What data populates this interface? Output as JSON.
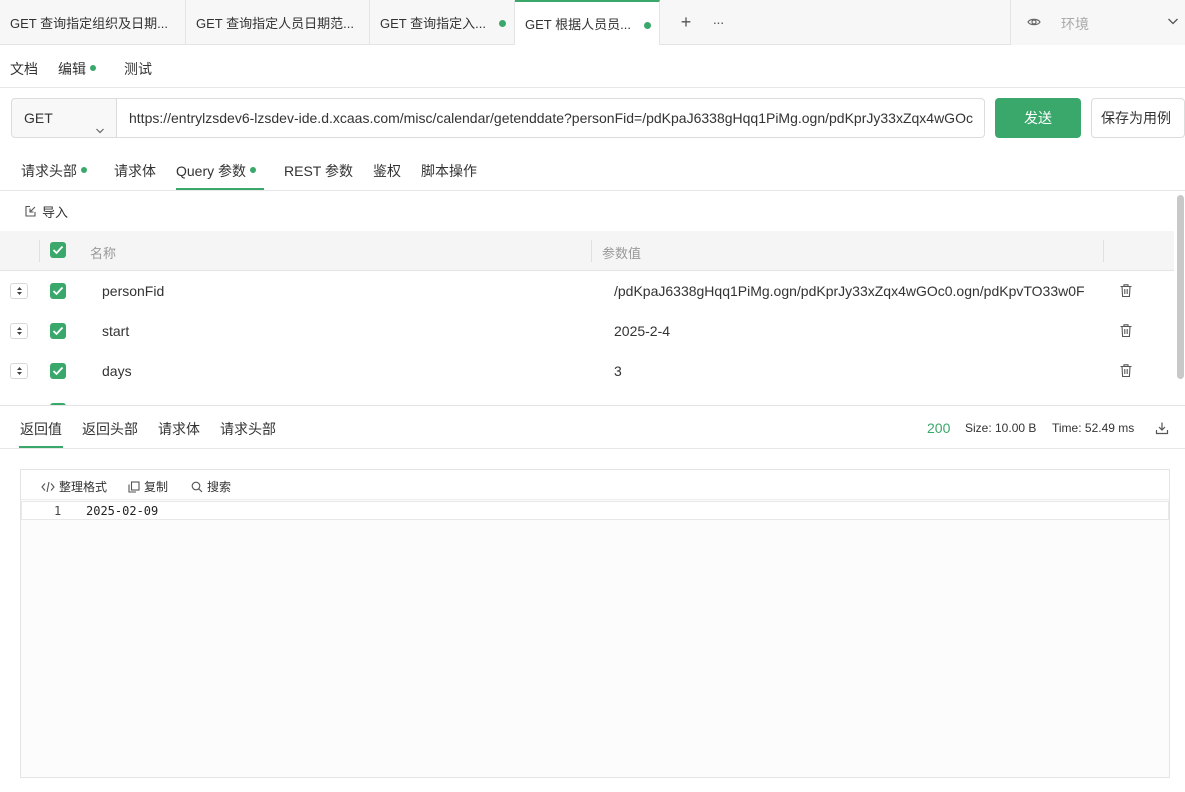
{
  "tabs": [
    {
      "label": "GET 查询指定组织及日期..."
    },
    {
      "label": "GET 查询指定人员日期范..."
    },
    {
      "label": "GET 查询指定入..."
    },
    {
      "label": "GET 根据人员员..."
    }
  ],
  "environment": {
    "label": "环境"
  },
  "subtabs": {
    "doc": "文档",
    "edit": "编辑",
    "test": "测试"
  },
  "request": {
    "method": "GET",
    "url": "https://entrylzsdev6-lzsdev-ide.d.xcaas.com/misc/calendar/getenddate?personFid=/pdKpaJ6338gHqq1PiMg.ogn/pdKprJy33xZqx4wGOc",
    "send_label": "发送",
    "save_label": "保存为用例"
  },
  "request_tabs": {
    "headers": "请求头部",
    "body": "请求体",
    "query": "Query 参数",
    "rest": "REST 参数",
    "auth": "鉴权",
    "script": "脚本操作"
  },
  "params": {
    "import_label": "导入",
    "col_name": "名称",
    "col_value": "参数值",
    "rows": [
      {
        "name": "personFid",
        "value": "/pdKpaJ6338gHqq1PiMg.ogn/pdKprJy33xZqx4wGOc0.ogn/pdKpvTO33w0F"
      },
      {
        "name": "start",
        "value": "2025-2-4"
      },
      {
        "name": "days",
        "value": "3"
      }
    ]
  },
  "response": {
    "tabs": {
      "body": "返回值",
      "headers": "返回头部",
      "req_body": "请求体",
      "req_headers": "请求头部"
    },
    "status": "200",
    "size": "Size: 10.00 B",
    "time": "Time: 52.49 ms",
    "toolbar": {
      "format": "整理格式",
      "copy": "复制",
      "search": "搜索"
    },
    "line_number": "1",
    "body": "2025-02-09"
  },
  "colors": {
    "accent": "#3aa86b"
  }
}
